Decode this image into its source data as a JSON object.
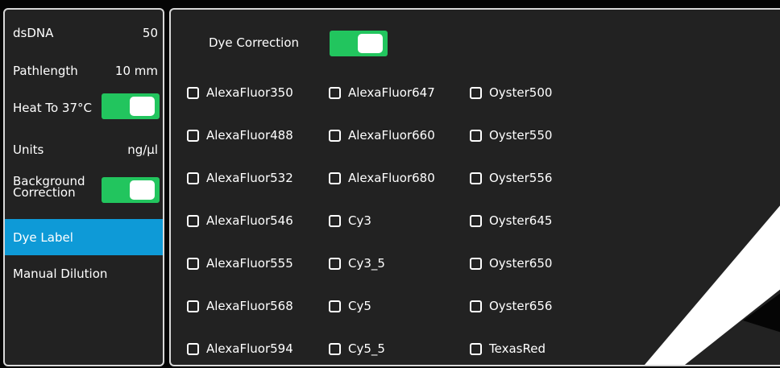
{
  "sidebar": {
    "dsdna": {
      "label": "dsDNA",
      "value": "50"
    },
    "pathlength": {
      "label": "Pathlength",
      "value": "10 mm"
    },
    "heat": {
      "label": "Heat To 37°C",
      "on": true
    },
    "units": {
      "label": "Units",
      "value": "ng/µl"
    },
    "background": {
      "label_line1": "Background",
      "label_line2": "Correction",
      "on": true
    },
    "dye_label": "Dye Label",
    "manual_dilution": "Manual Dilution"
  },
  "main": {
    "dye_correction": {
      "label": "Dye Correction",
      "on": true
    },
    "columns": [
      [
        "AlexaFluor350",
        "AlexaFluor488",
        "AlexaFluor532",
        "AlexaFluor546",
        "AlexaFluor555",
        "AlexaFluor568",
        "AlexaFluor594"
      ],
      [
        "AlexaFluor647",
        "AlexaFluor660",
        "AlexaFluor680",
        "Cy3",
        "Cy3_5",
        "Cy5",
        "Cy5_5"
      ],
      [
        "Oyster500",
        "Oyster550",
        "Oyster556",
        "Oyster645",
        "Oyster650",
        "Oyster656",
        "TexasRed"
      ]
    ]
  },
  "colors": {
    "accent_green": "#22c55e",
    "selected_blue": "#0e9ad7"
  }
}
